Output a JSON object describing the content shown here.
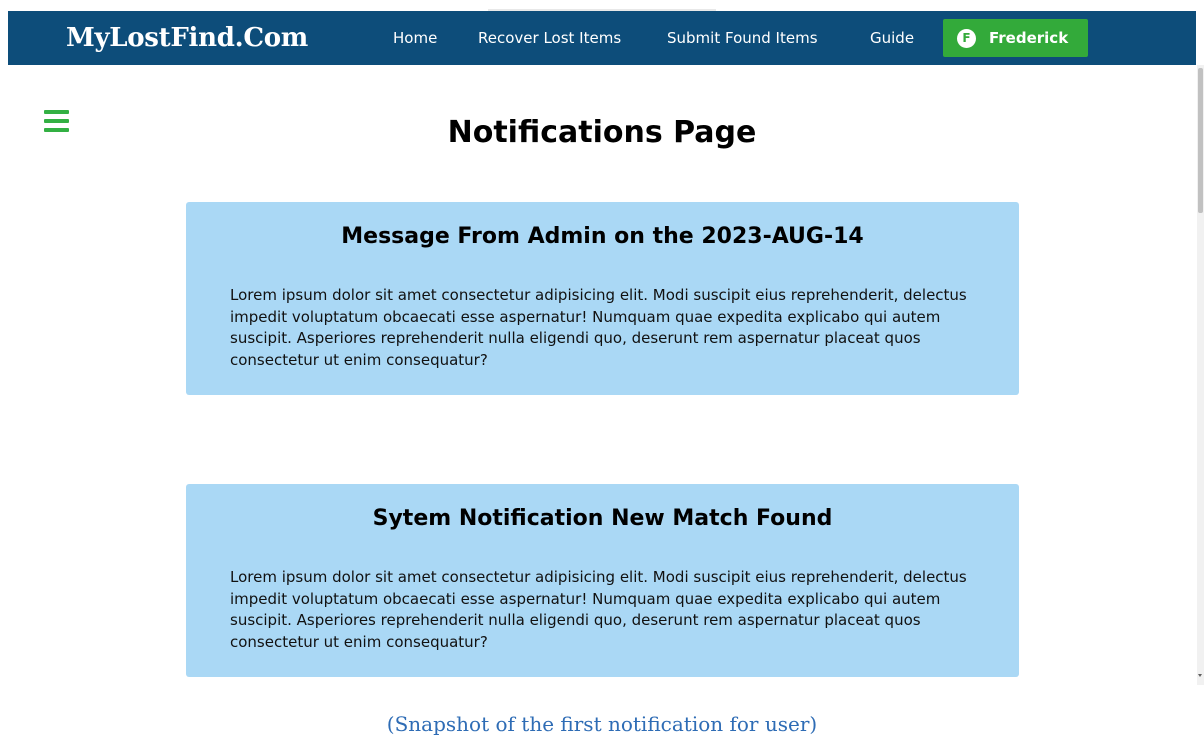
{
  "navbar": {
    "brand": "MyLostFind.Com",
    "links": [
      {
        "label": "Home"
      },
      {
        "label": "Recover Lost Items"
      },
      {
        "label": "Submit Found Items"
      },
      {
        "label": "Guide"
      }
    ],
    "user": {
      "initial": "F",
      "name": "Frederick"
    },
    "background_color": "#0d4d7a",
    "user_button_color": "#33aa3a"
  },
  "menu": {
    "icon": "hamburger-menu-icon",
    "color": "#33b043"
  },
  "page": {
    "title": "Notifications Page"
  },
  "notifications": [
    {
      "title": "Message From Admin on the 2023-AUG-14",
      "body": "Lorem ipsum dolor sit amet consectetur adipisicing elit. Modi suscipit eius reprehenderit, delectus impedit voluptatum obcaecati esse aspernatur! Numquam quae expedita explicabo qui autem suscipit. Asperiores reprehenderit nulla eligendi quo, deserunt rem aspernatur placeat quos consectetur ut enim consequatur?"
    },
    {
      "title": "Sytem Notification New Match Found",
      "body": "Lorem ipsum dolor sit amet consectetur adipisicing elit. Modi suscipit eius reprehenderit, delectus impedit voluptatum obcaecati esse aspernatur! Numquam quae expedita explicabo qui autem suscipit. Asperiores reprehenderit nulla eligendi quo, deserunt rem aspernatur placeat quos consectetur ut enim consequatur?"
    }
  ],
  "card_color": "#aad8f5",
  "caption": "(Snapshot of the first notification for user)",
  "caption_color": "#2e6cb5"
}
